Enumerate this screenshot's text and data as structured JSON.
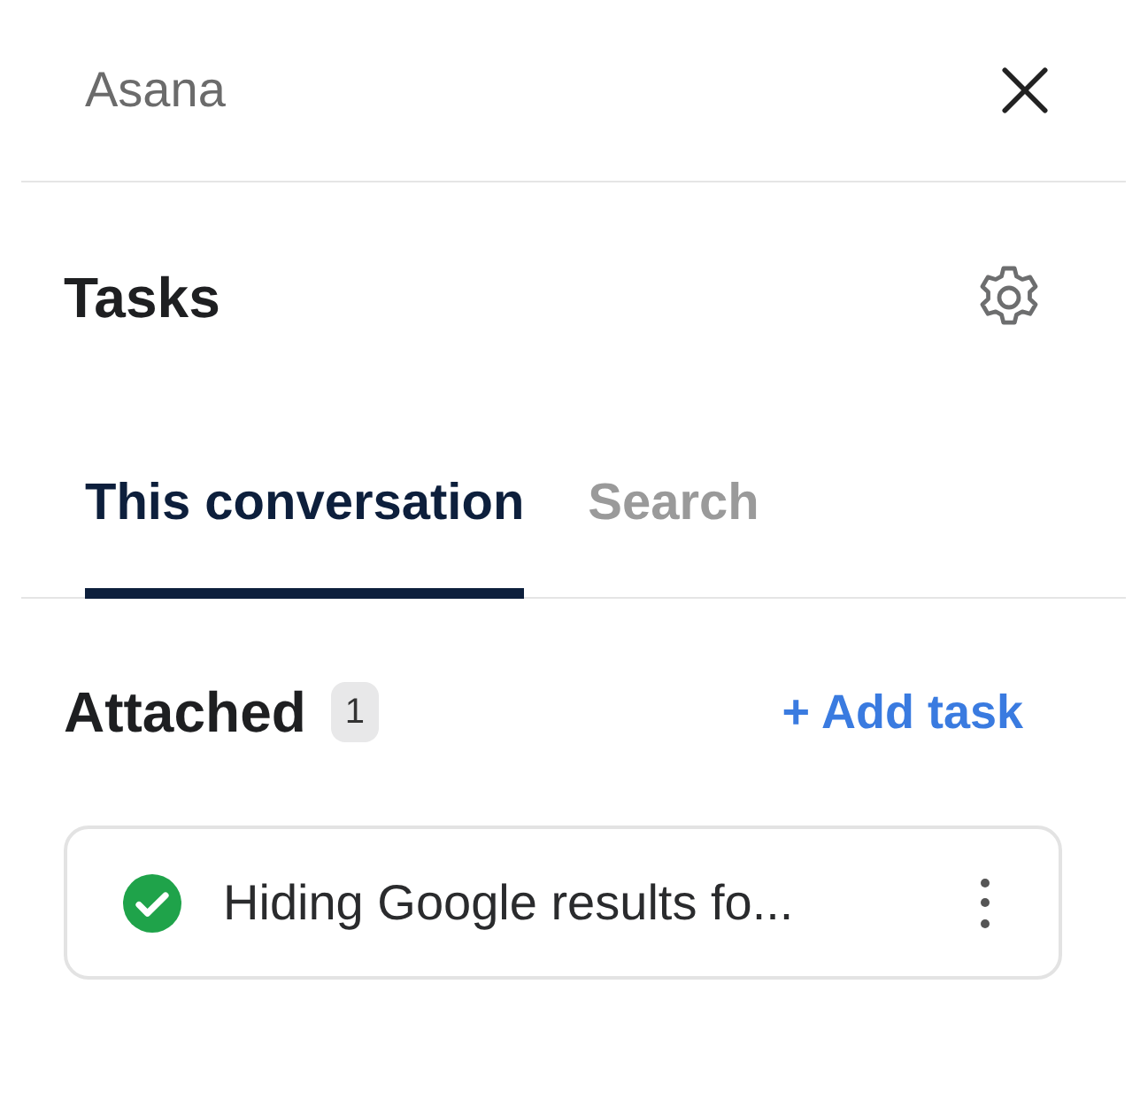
{
  "header": {
    "title": "Asana"
  },
  "panel": {
    "title": "Tasks"
  },
  "tabs": [
    {
      "label": "This conversation",
      "selected": true
    },
    {
      "label": "Search",
      "selected": false
    }
  ],
  "attached": {
    "title": "Attached",
    "count": "1",
    "action": "+ Add task"
  },
  "tasks": [
    {
      "title": "Hiding Google results fo...",
      "completed": true
    }
  ]
}
